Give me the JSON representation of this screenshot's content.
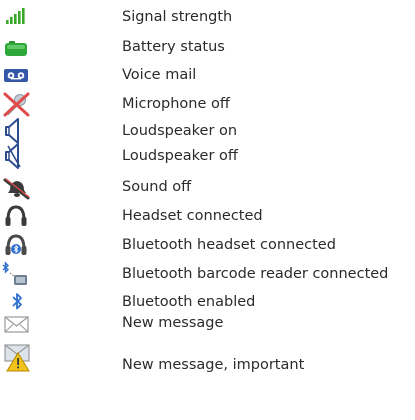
{
  "legend": {
    "items": [
      {
        "icon": "signal-strength-icon",
        "label": "Signal strength"
      },
      {
        "icon": "battery-icon",
        "label": "Battery status"
      },
      {
        "icon": "voicemail-icon",
        "label": "Voice mail"
      },
      {
        "icon": "microphone-off-icon",
        "label": "Microphone off"
      },
      {
        "icon": "loudspeaker-on-icon",
        "label": "Loudspeaker on"
      },
      {
        "icon": "loudspeaker-off-icon",
        "label": "Loudspeaker off"
      },
      {
        "icon": "sound-off-icon",
        "label": "Sound off"
      },
      {
        "icon": "headset-icon",
        "label": "Headset connected"
      },
      {
        "icon": "bluetooth-headset-icon",
        "label": "Bluetooth headset connected"
      },
      {
        "icon": "bluetooth-barcode-reader-icon",
        "label": "Bluetooth barcode reader connected"
      },
      {
        "icon": "bluetooth-icon",
        "label": "Bluetooth enabled"
      },
      {
        "icon": "new-message-icon",
        "label": "New message"
      },
      {
        "icon": "important-message-icon",
        "label": "New message, important"
      }
    ]
  },
  "colors": {
    "signal_green": "#3aa82a",
    "battery_green": "#2fa83a",
    "voicemail_blue": "#3457a8",
    "mic_red": "#e04b4b",
    "speaker_navy": "#2d4d8f",
    "bluetooth_blue": "#2f6fd0",
    "envelope_gray": "#9a9a9a",
    "warning_yellow": "#f2c318"
  }
}
